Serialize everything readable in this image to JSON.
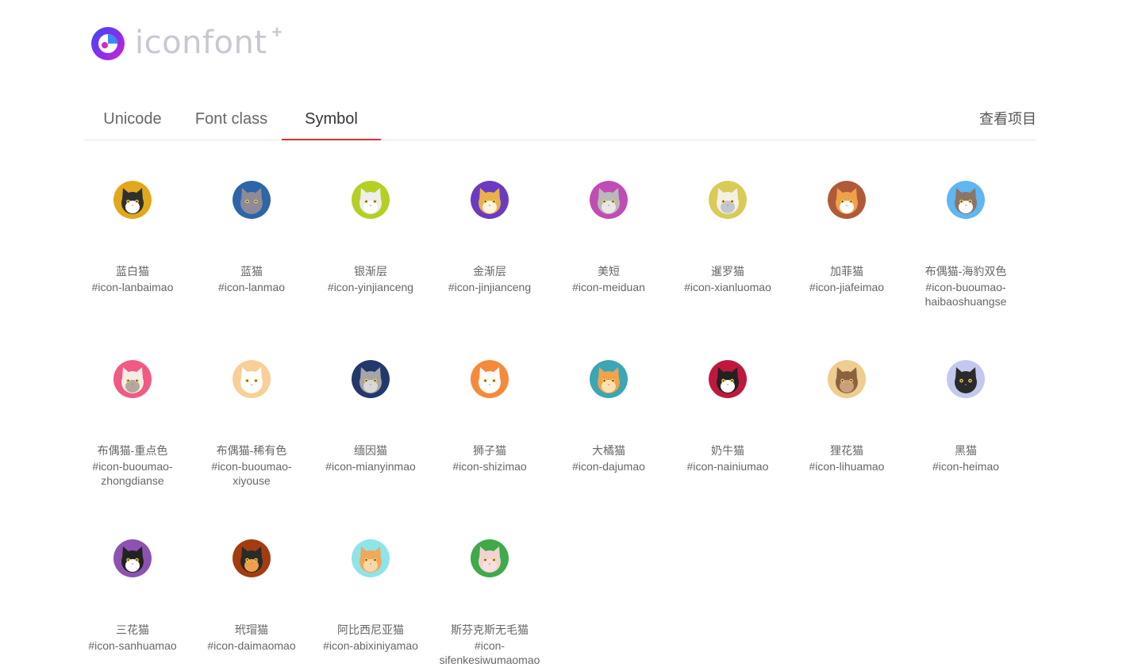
{
  "brand": {
    "name": "iconfont",
    "plus": "+"
  },
  "tabs": [
    {
      "label": "Unicode",
      "active": false
    },
    {
      "label": "Font class",
      "active": false
    },
    {
      "label": "Symbol",
      "active": true
    }
  ],
  "view_project": "查看项目",
  "accent_color": "#e02e2e",
  "icons": [
    {
      "name": "蓝白猫",
      "code": "#icon-lanbaimao",
      "bg": "#e1a81b",
      "fur": "#2f2f2f",
      "face": "#ffffff"
    },
    {
      "name": "蓝猫",
      "code": "#icon-lanmao",
      "bg": "#2e65a8",
      "fur": "#8c8b97",
      "face": "#8c8b97"
    },
    {
      "name": "银渐层",
      "code": "#icon-yinjianceng",
      "bg": "#b5cf24",
      "fur": "#eeeeee",
      "face": "#ffffff"
    },
    {
      "name": "金渐层",
      "code": "#icon-jinjianceng",
      "bg": "#6a3bc0",
      "fur": "#e9b04c",
      "face": "#fff4e0"
    },
    {
      "name": "美短",
      "code": "#icon-meiduan",
      "bg": "#c04db3",
      "fur": "#b9b9b9",
      "face": "#e8e8e8"
    },
    {
      "name": "暹罗猫",
      "code": "#icon-xianluomao",
      "bg": "#d8cb56",
      "fur": "#f5f0e6",
      "face": "#c0c7d0"
    },
    {
      "name": "加菲猫",
      "code": "#icon-jiafeimao",
      "bg": "#b05a3c",
      "fur": "#f0a04a",
      "face": "#ffffff"
    },
    {
      "name": "布偶猫-海豹双色",
      "code": "#icon-buoumao-haibaoshuangse",
      "bg": "#5fb6f0",
      "fur": "#8c7566",
      "face": "#ffffff"
    },
    {
      "name": "布偶猫-重点色",
      "code": "#icon-buoumao-zhongdianse",
      "bg": "#f05a84",
      "fur": "#f3ede6",
      "face": "#b3a7a0"
    },
    {
      "name": "布偶猫-稀有色",
      "code": "#icon-buoumao-xiyouse",
      "bg": "#f7cf97",
      "fur": "#ffffff",
      "face": "#ffffff"
    },
    {
      "name": "缅因猫",
      "code": "#icon-mianyinmao",
      "bg": "#24396b",
      "fur": "#a6a6a6",
      "face": "#d8d8d8"
    },
    {
      "name": "狮子猫",
      "code": "#icon-shizimao",
      "bg": "#f58a3c",
      "fur": "#fafafa",
      "face": "#ffffff"
    },
    {
      "name": "大橘猫",
      "code": "#icon-dajumao",
      "bg": "#3ba6b4",
      "fur": "#f2a24a",
      "face": "#ffe1b0"
    },
    {
      "name": "奶牛猫",
      "code": "#icon-nainiumao",
      "bg": "#c0183c",
      "fur": "#222222",
      "face": "#ffffff"
    },
    {
      "name": "狸花猫",
      "code": "#icon-lihuamao",
      "bg": "#edcd90",
      "fur": "#8a6242",
      "face": "#c9a079"
    },
    {
      "name": "黑猫",
      "code": "#icon-heimao",
      "bg": "#c3c8ef",
      "fur": "#2a2a2a",
      "face": "#2a2a2a"
    },
    {
      "name": "三花猫",
      "code": "#icon-sanhuamao",
      "bg": "#8c52b0",
      "fur": "#222222",
      "face": "#ffffff"
    },
    {
      "name": "玳瑁猫",
      "code": "#icon-daimaomao",
      "bg": "#a43c0f",
      "fur": "#2a2a2a",
      "face": "#f0a04a"
    },
    {
      "name": "阿比西尼亚猫",
      "code": "#icon-abixiniyamao",
      "bg": "#8fe4ea",
      "fur": "#f1a85a",
      "face": "#f8d8a8"
    },
    {
      "name": "斯芬克斯无毛猫",
      "code": "#icon-sifenkesiwumaomao",
      "bg": "#3eaa4a",
      "fur": "#f5d2d2",
      "face": "#f8e0e0"
    }
  ]
}
